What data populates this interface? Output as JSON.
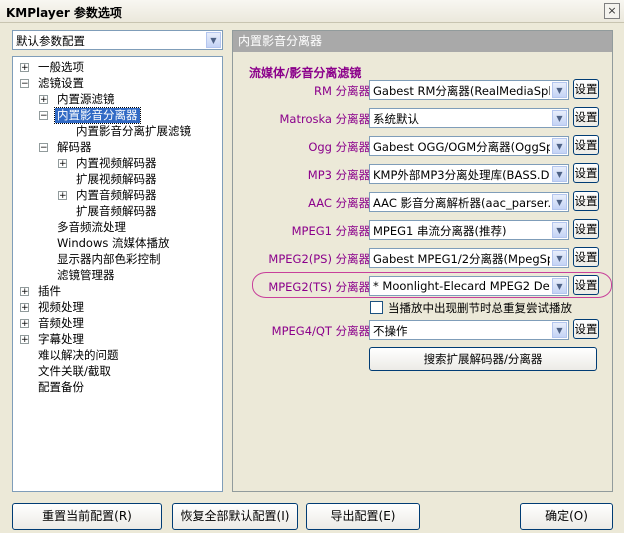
{
  "window": {
    "title": "KMPlayer 参数选项",
    "close_glyph": "×"
  },
  "profile_combo": {
    "value": "默认参数配置"
  },
  "tree": [
    {
      "label": "一般选项",
      "expander": "+"
    },
    {
      "label": "滤镜设置",
      "expander": "−"
    },
    {
      "label": "内置源滤镜",
      "expander": "+"
    },
    {
      "label": "内置影音分离器",
      "expander": "−",
      "selected": true
    },
    {
      "label": "内置影音分离扩展滤镜",
      "expander": ""
    },
    {
      "label": "解码器",
      "expander": "−"
    },
    {
      "label": "内置视频解码器",
      "expander": "+"
    },
    {
      "label": "扩展视频解码器",
      "expander": ""
    },
    {
      "label": "内置音频解码器",
      "expander": "+"
    },
    {
      "label": "扩展音频解码器",
      "expander": ""
    },
    {
      "label": "多音频流处理",
      "expander": ""
    },
    {
      "label": "Windows 流媒体播放",
      "expander": ""
    },
    {
      "label": "显示器内部色彩控制",
      "expander": ""
    },
    {
      "label": "滤镜管理器",
      "expander": ""
    },
    {
      "label": "插件",
      "expander": "+"
    },
    {
      "label": "视频处理",
      "expander": "+"
    },
    {
      "label": "音频处理",
      "expander": "+"
    },
    {
      "label": "字幕处理",
      "expander": "+"
    },
    {
      "label": "难以解决的问题",
      "expander": ""
    },
    {
      "label": "文件关联/截取",
      "expander": ""
    },
    {
      "label": "配置备份",
      "expander": ""
    }
  ],
  "panel": {
    "header": "内置影音分离器",
    "group_title": "流媒体/影音分离滤镜",
    "rows": [
      {
        "label": "RM 分离器:",
        "value": "Gabest RM分离器(RealMediaSplitter.",
        "button": "设置"
      },
      {
        "label": "Matroska 分离器:",
        "value": "系统默认",
        "button": "设置"
      },
      {
        "label": "Ogg 分离器:",
        "value": "Gabest OGG/OGM分离器(OggSplitter",
        "button": "设置"
      },
      {
        "label": "MP3 分离器:",
        "value": "KMP外部MP3分离处理库(BASS.DLL)",
        "button": "设置"
      },
      {
        "label": "AAC 分离器:",
        "value": "AAC 影音分离解析器(aac_parser.a:",
        "button": "设置"
      },
      {
        "label": "MPEG1 分离器:",
        "value": "MPEG1 串流分离器(推荐)",
        "button": "设置"
      },
      {
        "label": "MPEG2(PS) 分离器:",
        "value": "Gabest MPEG1/2分离器(MpegSplitter",
        "button": "设置"
      },
      {
        "label": "MPEG2(TS) 分离器:",
        "value": "* Moonlight-Elecard MPEG2 Demultiple",
        "button": "设置"
      },
      {
        "label": "MPEG4/QT 分离器:",
        "value": "不操作",
        "button": "设置"
      }
    ],
    "checkbox_label": "当播放中出现删节时总重复尝试播放",
    "search_button": "搜索扩展解码器/分离器"
  },
  "buttons": {
    "reset_current": "重置当前配置(R)",
    "restore_all": "恢复全部默认配置(I)",
    "export": "导出配置(E)",
    "ok": "确定(O)"
  },
  "colors": {
    "label_purple": "#8b008b",
    "highlight_ring": "#c8409a",
    "selection": "#316ac5",
    "panel_header": "#a9a9a9"
  },
  "icons": {
    "dropdown": "chevron-down-icon",
    "close": "close-icon",
    "expander": "tree-expander-icon"
  }
}
